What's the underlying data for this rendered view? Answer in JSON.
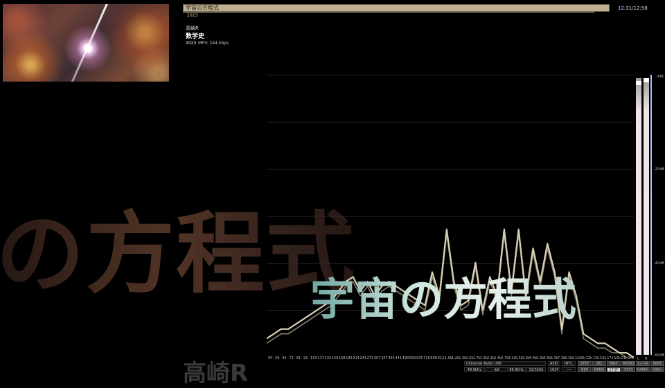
{
  "title_bar": {
    "track_title": "宇宙の方程式",
    "year": "2023",
    "clock": "12:31/12:58"
  },
  "track": {
    "artist": "高崎R",
    "album": "数学史",
    "year": "2023",
    "format": "MP3: 244 kbps"
  },
  "background": {
    "big_title": "の方程式",
    "big_artist": "高崎R"
  },
  "overlay_title": "宇宙の方程式",
  "db_labels": [
    "0dB",
    "-20dB",
    "-40dB",
    "-60dB"
  ],
  "meter_labels": [
    "L",
    "R"
  ],
  "frequencies": [
    "50",
    "56",
    "64",
    "72",
    "81",
    "92",
    "103",
    "117",
    "132",
    "149",
    "168",
    "189",
    "214",
    "241",
    "272",
    "307",
    "347",
    "391",
    "441",
    "498",
    "562",
    "635",
    "716",
    "808",
    "912",
    "1.0k",
    "1.2k",
    "1.3k",
    "1.5k",
    "1.7k",
    "1.9k",
    "2.1k",
    "2.4k",
    "2.7k",
    "3.1k",
    "3.5k",
    "3.9k",
    "4.4k",
    "5.0k",
    "5.6k",
    "6.3k",
    "7.1k",
    "8.1k",
    "9.1k",
    "10k",
    "12k",
    "13k",
    "15k",
    "17k",
    "19k",
    "21k",
    "24k"
  ],
  "chart_data": {
    "type": "line",
    "ylim": [
      -60,
      0
    ],
    "series": [
      {
        "values": [
          -56,
          -55,
          -54,
          -54,
          -53,
          -52,
          -51,
          -50,
          -49,
          -48,
          -46,
          -44,
          -43,
          -46,
          -44,
          -47,
          -45,
          -44,
          -45,
          -46,
          -47,
          -48,
          -49,
          -42,
          -47,
          -33,
          -44,
          -49,
          -48,
          -40,
          -50,
          -43,
          -47,
          -33,
          -46,
          -33,
          -47,
          -37,
          -44,
          -36,
          -42,
          -54,
          -42,
          -47,
          -55,
          -56,
          -57,
          -57,
          -58,
          -59,
          -59,
          -60
        ]
      },
      {
        "values": [
          -57,
          -56,
          -55,
          -55,
          -54,
          -53,
          -52,
          -51,
          -50,
          -49,
          -47,
          -45,
          -44,
          -47,
          -45,
          -48,
          -46,
          -45,
          -46,
          -47,
          -48,
          -49,
          -50,
          -43,
          -48,
          -34,
          -45,
          -50,
          -49,
          -41,
          -51,
          -44,
          -48,
          -34,
          -47,
          -34,
          -48,
          -38,
          -45,
          -37,
          -43,
          -55,
          -43,
          -48,
          -56,
          -57,
          -58,
          -58,
          -59,
          -59,
          -60,
          -60
        ]
      }
    ]
  },
  "status": {
    "device": "Universal Audio USB",
    "asio": "ASIO",
    "int_l": "INT:L",
    "sample_rate": "48.0kHz",
    "bit": "--bit",
    "out_rate": "96.0kHz",
    "bits": "32/32bit",
    "buffer": "1024",
    "dashes": "----",
    "buttons_row1": [
      "DITP",
      "RG",
      "MAX",
      "MONO",
      "L<>R",
      "WAIT"
    ],
    "buttons_row2": [
      "REP",
      "RAND",
      "STOP",
      "VST3",
      "RAMIX",
      "CRWL"
    ]
  }
}
